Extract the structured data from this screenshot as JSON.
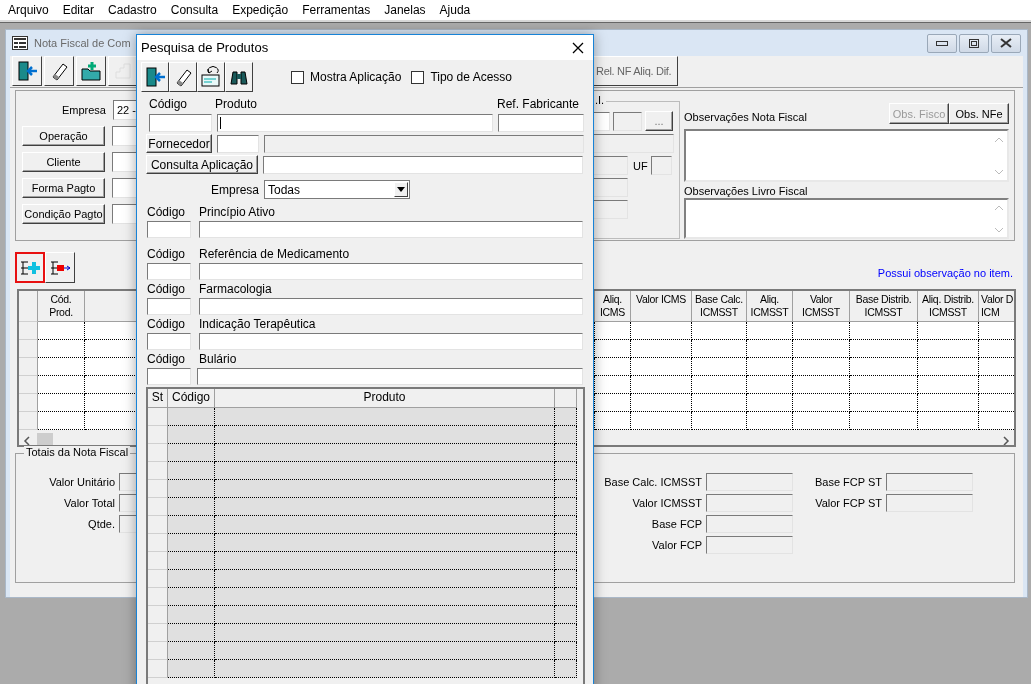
{
  "menu": [
    "Arquivo",
    "Editar",
    "Cadastro",
    "Consulta",
    "Expedição",
    "Ferramentas",
    "Janelas",
    "Ajuda"
  ],
  "main_window": {
    "title": "Nota Fiscal de Com",
    "toolbar": [
      {
        "disabled": false
      },
      {
        "disabled": false
      },
      {
        "disabled": false
      },
      {
        "disabled": true
      }
    ],
    "report_button": "Rel. NF Aliq. Dif.",
    "empresa": {
      "label": "Empresa",
      "value": "22 -"
    },
    "lookup_buttons": [
      "Operação",
      "Cliente",
      "Forma Pagto",
      "Condição Pagto"
    ],
    "group_legend": ".I.",
    "ellipsis_button": "...",
    "uf_label": "UF",
    "obs_nota_label": "Observações Nota Fiscal",
    "obs_buttons": [
      {
        "label": "Obs. Fisco",
        "disabled": true
      },
      {
        "label": "Obs. NFe",
        "disabled": false
      }
    ],
    "obs_livro_label": "Observações Livro Fiscal",
    "item_buttons": [
      {
        "selected": true
      },
      {
        "selected": false
      }
    ],
    "item_note": "Possui observação no item.",
    "items_table": {
      "columns": [
        "Cód.\nProd.",
        "Aliq.\nICMS",
        "Valor ICMS",
        "Base Calc.\nICMSST",
        "Aliq.\nICMSST",
        "Valor\nICMSST",
        "Base Distrib.\nICMSST",
        "Aliq. Distrib.\nICMSST",
        "Valor D\nICM"
      ]
    },
    "totals": {
      "title": "Totais da Nota Fiscal",
      "left": [
        "Valor Unitário",
        "Valor Total",
        "Qtde."
      ],
      "middle": [
        "Base Calc. ICMSST",
        "Valor ICMSST",
        "Base FCP",
        "Valor FCP"
      ],
      "right": [
        "Base FCP ST",
        "Valor FCP ST"
      ]
    }
  },
  "dialog": {
    "title": "Pesquisa de Produtos",
    "options": [
      {
        "label": "Mostra Aplicação",
        "checked": false
      },
      {
        "label": "Tipo de Acesso",
        "checked": false
      }
    ],
    "code_label": "Código",
    "product_label": "Produto",
    "ref_label": "Ref. Fabricante",
    "fornecedor_button": "Fornecedor",
    "aplicacao_button": "Consulta Aplicação",
    "empresa": {
      "label": "Empresa",
      "value": "Todas"
    },
    "filters": [
      {
        "code_label": "Código",
        "label": "Princípio Ativo"
      },
      {
        "code_label": "Código",
        "label": "Referência de Medicamento"
      },
      {
        "code_label": "Código",
        "label": "Farmacologia"
      },
      {
        "code_label": "Código",
        "label": "Indicação Terapêutica"
      },
      {
        "code_label": "Código",
        "label": "Bulário"
      }
    ],
    "results": {
      "columns": [
        "St",
        "Código",
        "Produto"
      ]
    }
  }
}
